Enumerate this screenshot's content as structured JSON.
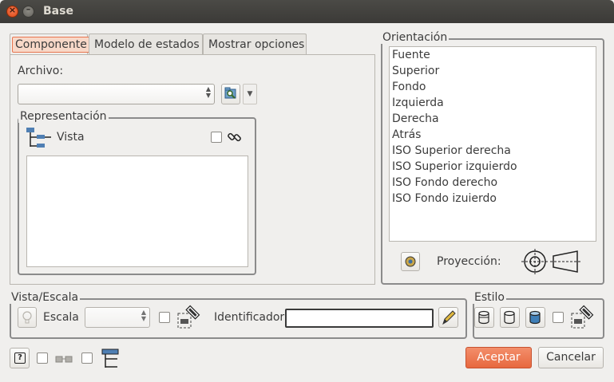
{
  "window": {
    "title": "Base"
  },
  "tabs": [
    "Componente",
    "Modelo de estados",
    "Mostrar opciones"
  ],
  "archivo": {
    "label": "Archivo:",
    "value": ""
  },
  "representacion": {
    "label": "Representación",
    "vista_label": "Vista"
  },
  "orientacion": {
    "label": "Orientación",
    "items": [
      "Fuente",
      "Superior",
      "Fondo",
      "Izquierda",
      "Derecha",
      "Atrás",
      "ISO Superior derecha",
      "ISO Superior izquierdo",
      "ISO Fondo derecho",
      "ISO Fondo izuierdo"
    ],
    "proyeccion_label": "Proyección:"
  },
  "vista_escala": {
    "label": "Vista/Escala",
    "escala_label": "Escala",
    "escala_value": "",
    "identificador_label": "Identificador",
    "identificador_value": ""
  },
  "estilo": {
    "label": "Estilo"
  },
  "footer": {
    "accept_label": "Aceptar",
    "cancel_label": "Cancelar",
    "help_glyph": "?"
  },
  "colors": {
    "accent": "#e7683f",
    "titlebar": "#3b3a37"
  }
}
